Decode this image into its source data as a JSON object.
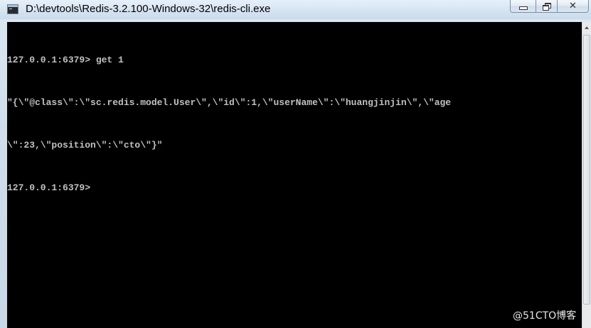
{
  "window": {
    "title": "D:\\devtools\\Redis-3.2.100-Windows-32\\redis-cli.exe",
    "app_icon": "console-app-icon",
    "controls": {
      "minimize_icon": "minimize-icon",
      "maximize_icon": "restore-icon",
      "close_icon": "close-icon",
      "close_glyph": "✕"
    }
  },
  "console": {
    "lines": [
      "127.0.0.1:6379> get 1",
      "\"{\\\"@class\\\":\\\"sc.redis.model.User\\\",\\\"id\\\":1,\\\"userName\\\":\\\"huangjinjin\\\",\\\"age",
      "\\\":23,\\\"position\\\":\\\"cto\\\"}\"",
      "127.0.0.1:6379>"
    ],
    "text_color": "#c0c0c0",
    "background": "#000000"
  },
  "watermark": "@51CTO博客"
}
